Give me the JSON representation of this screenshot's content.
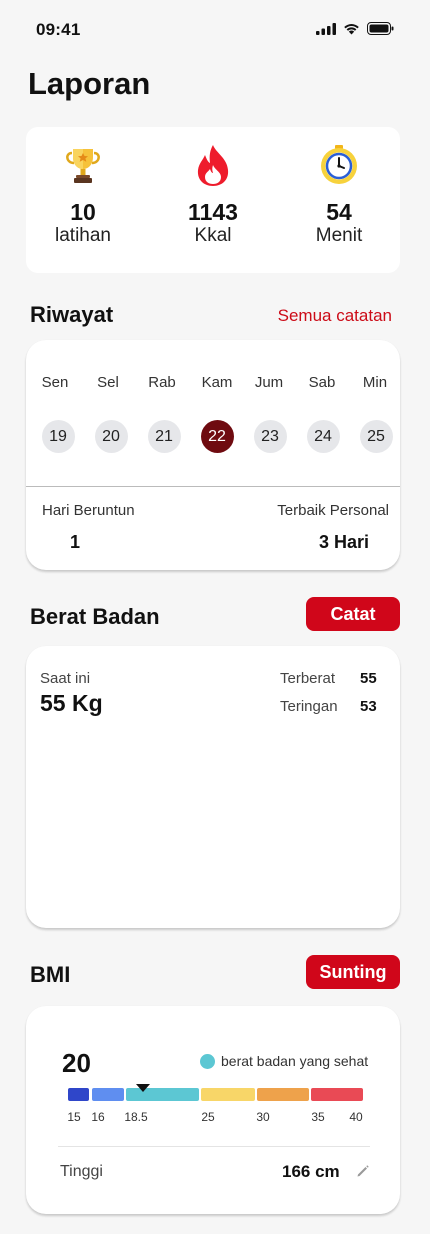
{
  "status_bar": {
    "time": "09:41"
  },
  "page_title": "Laporan",
  "summary": [
    {
      "icon": "trophy-icon",
      "value": "10",
      "label": "latihan"
    },
    {
      "icon": "flame-icon",
      "value": "1143",
      "label": "Kkal"
    },
    {
      "icon": "stopwatch-icon",
      "value": "54",
      "label": "Menit"
    }
  ],
  "history": {
    "title": "Riwayat",
    "all_records_label": "Semua catatan",
    "days": [
      {
        "name": "Sen",
        "date": "19",
        "active": false
      },
      {
        "name": "Sel",
        "date": "20",
        "active": false
      },
      {
        "name": "Rab",
        "date": "21",
        "active": false
      },
      {
        "name": "Kam",
        "date": "22",
        "active": true
      },
      {
        "name": "Jum",
        "date": "23",
        "active": false
      },
      {
        "name": "Sab",
        "date": "24",
        "active": false
      },
      {
        "name": "Min",
        "date": "25",
        "active": false
      }
    ],
    "streak_label": "Hari Beruntun",
    "streak_value": "1",
    "best_label": "Terbaik Personal",
    "best_value": "3 Hari"
  },
  "weight": {
    "title": "Berat Badan",
    "record_button": "Catat",
    "current_label": "Saat ini",
    "current_value": "55 Kg",
    "heaviest_label": "Terberat",
    "heaviest_value": "55",
    "lightest_label": "Teringan",
    "lightest_value": "53"
  },
  "bmi": {
    "title": "BMI",
    "edit_button": "Sunting",
    "value": "20",
    "legend_label": "berat badan yang sehat",
    "scale_ticks": [
      "15",
      "16",
      "18.5",
      "25",
      "30",
      "35",
      "40"
    ],
    "height_label": "Tinggi",
    "height_value": "166 cm"
  },
  "colors": {
    "accent": "#d0061a",
    "active_date": "#6f0b10",
    "bmi_segments": [
      "#2f46c9",
      "#5f8ef0",
      "#5cc7d3",
      "#f8d668",
      "#eea24b",
      "#e94a55"
    ]
  }
}
